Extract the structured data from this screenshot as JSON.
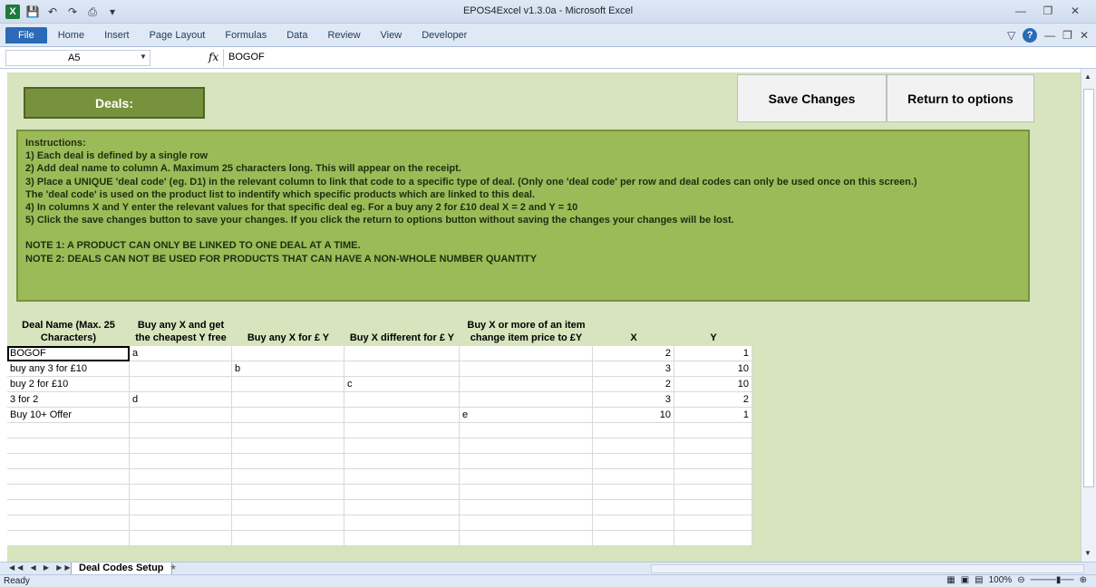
{
  "window": {
    "title": "EPOS4Excel v1.3.0a  -  Microsoft Excel"
  },
  "ribbon": {
    "tabs": [
      "File",
      "Home",
      "Insert",
      "Page Layout",
      "Formulas",
      "Data",
      "Review",
      "View",
      "Developer"
    ]
  },
  "formula_bar": {
    "name_box": "A5",
    "fx_label": "fx",
    "value": "BOGOF"
  },
  "sheet": {
    "deals_label": "Deals:",
    "save_button": "Save Changes",
    "return_button": "Return to options",
    "instructions": [
      "Instructions:",
      "1) Each deal is defined by a single row",
      "2) Add deal name to column A. Maximum 25 characters long. This will appear on the receipt.",
      "3) Place a UNIQUE 'deal code' (eg. D1)  in the relevant column to link that code to a specific type of deal. (Only one 'deal code' per row and deal codes can only be used once on this screen.)",
      "The 'deal code' is used on the product list to indentify which specific products which are linked to this deal.",
      "4) In columns X and Y enter the relevant values for that specific deal eg. For a buy any 2 for £10 deal X = 2 and Y = 10",
      "5) Click the save changes button to save your changes. If you click the return to options button without saving the changes your changes will be lost.",
      "",
      "NOTE 1: A PRODUCT CAN ONLY BE LINKED TO ONE DEAL AT A TIME.",
      "NOTE 2: DEALS CAN NOT BE USED FOR PRODUCTS THAT CAN HAVE A NON-WHOLE NUMBER QUANTITY"
    ],
    "headers": [
      "Deal Name (Max. 25 Characters)",
      "Buy any X and get the cheapest Y free",
      "Buy any X for £ Y",
      "Buy X different for £ Y",
      "Buy X or more of an item change item price to £Y",
      "X",
      "Y"
    ],
    "rows": [
      [
        "BOGOF",
        "a",
        "",
        "",
        "",
        "2",
        "1"
      ],
      [
        "buy any 3 for £10",
        "",
        "b",
        "",
        "",
        "3",
        "10"
      ],
      [
        "buy 2 for £10",
        "",
        "",
        "c",
        "",
        "2",
        "10"
      ],
      [
        "3 for 2",
        "d",
        "",
        "",
        "",
        "3",
        "2"
      ],
      [
        "Buy 10+ Offer",
        "",
        "",
        "",
        "e",
        "10",
        "1"
      ],
      [
        "",
        "",
        "",
        "",
        "",
        "",
        ""
      ],
      [
        "",
        "",
        "",
        "",
        "",
        "",
        ""
      ],
      [
        "",
        "",
        "",
        "",
        "",
        "",
        ""
      ],
      [
        "",
        "",
        "",
        "",
        "",
        "",
        ""
      ],
      [
        "",
        "",
        "",
        "",
        "",
        "",
        ""
      ],
      [
        "",
        "",
        "",
        "",
        "",
        "",
        ""
      ],
      [
        "",
        "",
        "",
        "",
        "",
        "",
        ""
      ],
      [
        "",
        "",
        "",
        "",
        "",
        "",
        ""
      ]
    ]
  },
  "sheet_tabs": {
    "active": "Deal Codes Setup"
  },
  "status": {
    "ready": "Ready",
    "zoom": "100%"
  }
}
